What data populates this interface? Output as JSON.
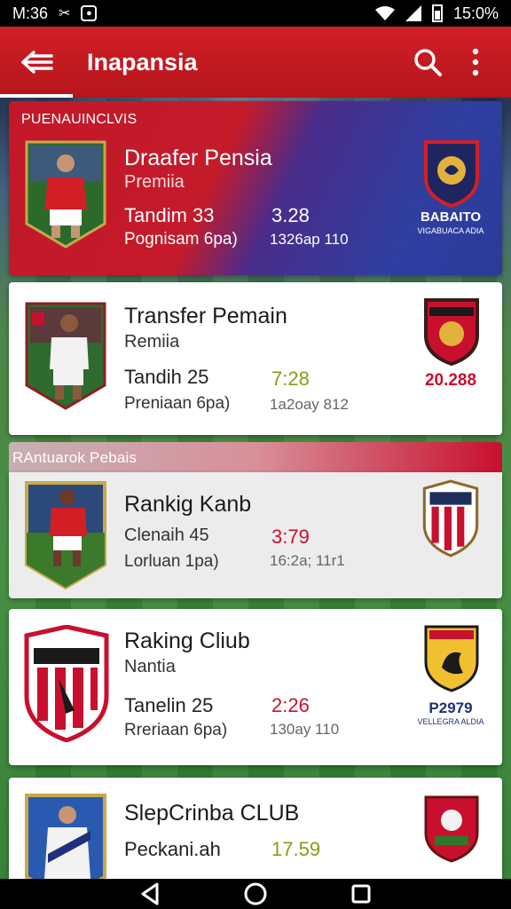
{
  "status_bar": {
    "time": "M:36",
    "battery": "15:0%"
  },
  "app_bar": {
    "title": "Inapansia"
  },
  "featured": {
    "section_label": "PUENAUINCLVIS",
    "name": "Draafer Pensia",
    "sub": "Premiia",
    "stat": "Tandim  33",
    "stat2": "Pognisam  6pa)",
    "val": "3.28",
    "val2": "1326ap  110",
    "crest_text": "BABAITO",
    "crest_sub": "VIGABUACA ADIA",
    "colors": {
      "red": "#c41b2b",
      "blue": "#2e3fa0"
    }
  },
  "cards": [
    {
      "name": "Transfer Pemain",
      "sub": "Remiia",
      "stat": "Tandih  25",
      "stat2": "Preniaan  6pa)",
      "val": "7:28",
      "val_color": "#8a9a1a",
      "val2": "1a2oay  812",
      "crest_text": "20.288",
      "crest_text_color": "#c8102e"
    },
    {
      "name": "Rankig Kanb",
      "sub": "Clenaih  45",
      "stat": "Lorluan  1pa)",
      "val": "3:79",
      "val_color": "#c8102e",
      "val2": "16:2a;  11r1"
    },
    {
      "name": "Raking Cliub",
      "sub": "Nantia",
      "stat": "Tanelin  25",
      "stat2": "Rreriaan  6pa)",
      "val": "2:26",
      "val_color": "#c8102e",
      "val2": "130ay  110",
      "crest_text": "P2979",
      "crest_text_color": "#1f2f7a",
      "crest_sub": "VELLEGRA ALDIA"
    },
    {
      "name": "SlepCrinba CLUB",
      "stat": "Peckani.ah",
      "val": "17.59",
      "val_color": "#8a9a1a"
    }
  ],
  "section2_label": "RAntuarok Pebais"
}
